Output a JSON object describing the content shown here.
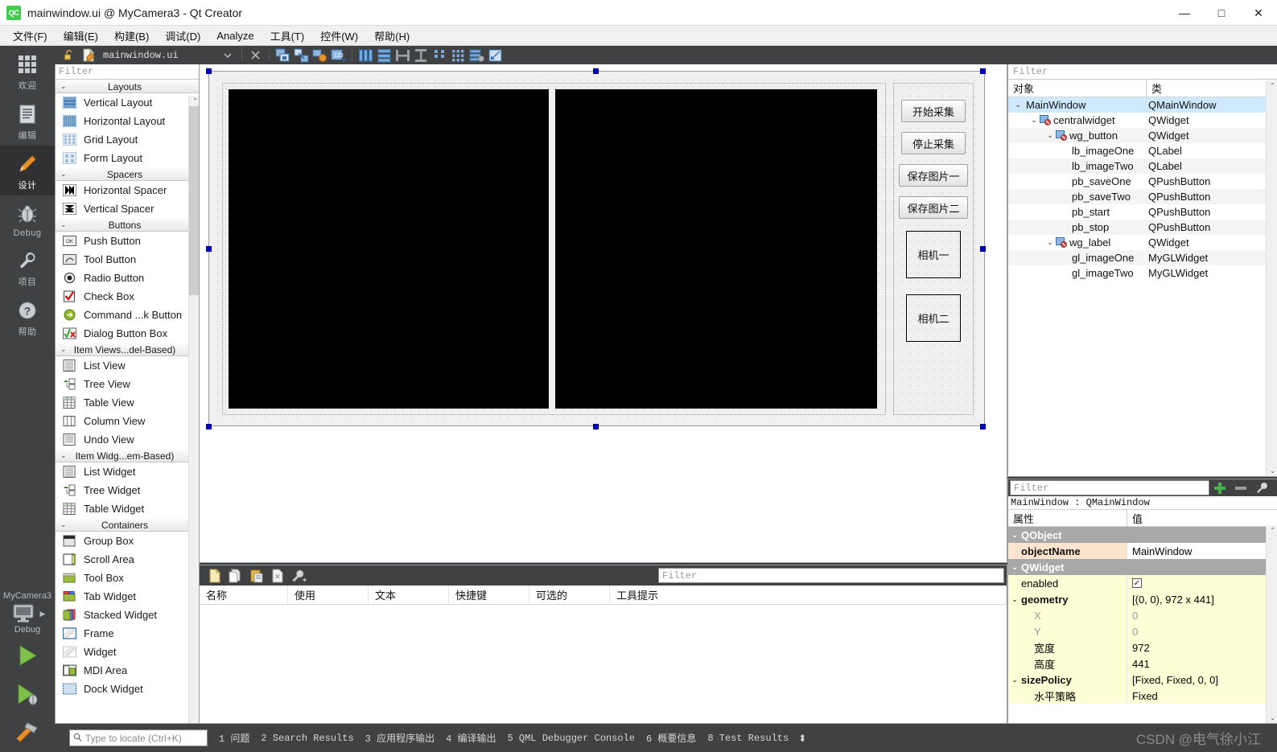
{
  "window": {
    "title": "mainwindow.ui @ MyCamera3 - Qt Creator",
    "logo": "QC",
    "controls": {
      "minimize": "—",
      "maximize": "□",
      "close": "✕"
    }
  },
  "menubar": {
    "items": [
      {
        "label": "文件(F)"
      },
      {
        "label": "编辑(E)"
      },
      {
        "label": "构建(B)"
      },
      {
        "label": "调试(D)"
      },
      {
        "label": "Analyze"
      },
      {
        "label": "工具(T)"
      },
      {
        "label": "控件(W)"
      },
      {
        "label": "帮助(H)"
      }
    ]
  },
  "activitybar": {
    "items": [
      {
        "label": "欢迎",
        "icon": "grid-icon"
      },
      {
        "label": "编辑",
        "icon": "document-icon"
      },
      {
        "label": "设计",
        "icon": "pencil-icon"
      },
      {
        "label": "Debug",
        "icon": "bug-icon"
      },
      {
        "label": "项目",
        "icon": "wrench-icon"
      },
      {
        "label": "帮助",
        "icon": "question-icon"
      }
    ],
    "active_index": 2,
    "kit": {
      "project": "MyCamera3",
      "config": "Debug"
    }
  },
  "editor_toolbar": {
    "filename": "mainwindow.ui",
    "lock_icon": "unlock-icon",
    "file_icon": "ui-file-icon",
    "dropdown_icon": "chevron-down-icon",
    "close_icon": "close-icon",
    "tool_icons": [
      "edit-widgets-icon",
      "edit-signals-icon",
      "edit-buddies-icon",
      "edit-tab-order-icon",
      "layout-horizontal-icon",
      "layout-vertical-icon",
      "layout-splitter-h-icon",
      "layout-splitter-v-icon",
      "layout-form-icon",
      "layout-grid-icon",
      "break-layout-icon",
      "adjust-size-icon"
    ]
  },
  "widget_box": {
    "filter_placeholder": "Filter",
    "groups": [
      {
        "title": "Layouts",
        "expanded": true,
        "items": [
          {
            "label": "Vertical Layout",
            "icon": "vertical-layout-icon"
          },
          {
            "label": "Horizontal Layout",
            "icon": "horizontal-layout-icon"
          },
          {
            "label": "Grid Layout",
            "icon": "grid-layout-icon"
          },
          {
            "label": "Form Layout",
            "icon": "form-layout-icon"
          }
        ]
      },
      {
        "title": "Spacers",
        "expanded": true,
        "items": [
          {
            "label": "Horizontal Spacer",
            "icon": "horizontal-spacer-icon"
          },
          {
            "label": "Vertical Spacer",
            "icon": "vertical-spacer-icon"
          }
        ]
      },
      {
        "title": "Buttons",
        "expanded": true,
        "items": [
          {
            "label": "Push Button",
            "icon": "push-button-icon"
          },
          {
            "label": "Tool Button",
            "icon": "tool-button-icon"
          },
          {
            "label": "Radio Button",
            "icon": "radio-button-icon"
          },
          {
            "label": "Check Box",
            "icon": "check-box-icon"
          },
          {
            "label": "Command ...k Button",
            "icon": "command-link-icon"
          },
          {
            "label": "Dialog Button Box",
            "icon": "dialog-button-box-icon"
          }
        ]
      },
      {
        "title": "Item Views...del-Based)",
        "expanded": true,
        "items": [
          {
            "label": "List View",
            "icon": "list-view-icon"
          },
          {
            "label": "Tree View",
            "icon": "tree-view-icon"
          },
          {
            "label": "Table View",
            "icon": "table-view-icon"
          },
          {
            "label": "Column View",
            "icon": "column-view-icon"
          },
          {
            "label": "Undo View",
            "icon": "undo-view-icon"
          }
        ]
      },
      {
        "title": "Item Widg...em-Based)",
        "expanded": true,
        "items": [
          {
            "label": "List Widget",
            "icon": "list-widget-icon"
          },
          {
            "label": "Tree Widget",
            "icon": "tree-widget-icon"
          },
          {
            "label": "Table Widget",
            "icon": "table-widget-icon"
          }
        ]
      },
      {
        "title": "Containers",
        "expanded": true,
        "items": [
          {
            "label": "Group Box",
            "icon": "group-box-icon"
          },
          {
            "label": "Scroll Area",
            "icon": "scroll-area-icon"
          },
          {
            "label": "Tool Box",
            "icon": "tool-box-icon"
          },
          {
            "label": "Tab Widget",
            "icon": "tab-widget-icon"
          },
          {
            "label": "Stacked Widget",
            "icon": "stacked-widget-icon"
          },
          {
            "label": "Frame",
            "icon": "frame-icon"
          },
          {
            "label": "Widget",
            "icon": "widget-icon"
          },
          {
            "label": "MDI Area",
            "icon": "mdi-area-icon"
          },
          {
            "label": "Dock Widget",
            "icon": "dock-widget-icon"
          }
        ]
      }
    ]
  },
  "form": {
    "gl_widgets": [
      {
        "name": "gl_imageOne"
      },
      {
        "name": "gl_imageTwo"
      }
    ],
    "buttons": [
      {
        "label": "开始采集",
        "name": "pb_start"
      },
      {
        "label": "停止采集",
        "name": "pb_stop"
      },
      {
        "label": "保存图片一",
        "name": "pb_saveOne"
      },
      {
        "label": "保存图片二",
        "name": "pb_saveTwo"
      }
    ],
    "labels": [
      {
        "label": "相机一",
        "name": "lb_imageOne"
      },
      {
        "label": "相机二",
        "name": "lb_imageTwo"
      }
    ]
  },
  "action_editor": {
    "filter_placeholder": "Filter",
    "tool_icons": [
      "new-action-icon",
      "copy-icon",
      "paste-icon",
      "delete-icon",
      "configure-icon"
    ],
    "columns": [
      "名称",
      "使用",
      "文本",
      "快捷键",
      "可选的",
      "工具提示"
    ],
    "rows": []
  },
  "object_inspector": {
    "filter_placeholder": "Filter",
    "columns": [
      "对象",
      "类"
    ],
    "rows": [
      {
        "object": "MainWindow",
        "class": "QMainWindow",
        "indent": 0,
        "chevron": true,
        "icon": null,
        "selected": true
      },
      {
        "object": "centralwidget",
        "class": "QWidget",
        "indent": 1,
        "chevron": true,
        "icon": "layout-none-icon",
        "selected": false
      },
      {
        "object": "wg_button",
        "class": "QWidget",
        "indent": 2,
        "chevron": true,
        "icon": "layout-none-icon",
        "selected": false
      },
      {
        "object": "lb_imageOne",
        "class": "QLabel",
        "indent": 3,
        "chevron": false,
        "icon": null,
        "selected": false
      },
      {
        "object": "lb_imageTwo",
        "class": "QLabel",
        "indent": 3,
        "chevron": false,
        "icon": null,
        "selected": false
      },
      {
        "object": "pb_saveOne",
        "class": "QPushButton",
        "indent": 3,
        "chevron": false,
        "icon": null,
        "selected": false
      },
      {
        "object": "pb_saveTwo",
        "class": "QPushButton",
        "indent": 3,
        "chevron": false,
        "icon": null,
        "selected": false
      },
      {
        "object": "pb_start",
        "class": "QPushButton",
        "indent": 3,
        "chevron": false,
        "icon": null,
        "selected": false
      },
      {
        "object": "pb_stop",
        "class": "QPushButton",
        "indent": 3,
        "chevron": false,
        "icon": null,
        "selected": false
      },
      {
        "object": "wg_label",
        "class": "QWidget",
        "indent": 2,
        "chevron": true,
        "icon": "layout-none-icon",
        "selected": false
      },
      {
        "object": "gl_imageOne",
        "class": "MyGLWidget",
        "indent": 3,
        "chevron": false,
        "icon": null,
        "selected": false
      },
      {
        "object": "gl_imageTwo",
        "class": "MyGLWidget",
        "indent": 3,
        "chevron": false,
        "icon": null,
        "selected": false
      }
    ]
  },
  "property_editor": {
    "filter_placeholder": "Filter",
    "add_icon": "plus-icon",
    "remove_icon": "minus-icon",
    "config_icon": "wrench-icon",
    "subject": "MainWindow : QMainWindow",
    "columns": [
      "属性",
      "值"
    ],
    "rows": [
      {
        "key": "QObject",
        "value": "",
        "type": "group",
        "indent": 0,
        "chevron": true
      },
      {
        "key": "objectName",
        "value": "MainWindow",
        "type": "orange",
        "indent": 1,
        "chevron": false,
        "bold": true
      },
      {
        "key": "QWidget",
        "value": "",
        "type": "group",
        "indent": 0,
        "chevron": true
      },
      {
        "key": "enabled",
        "value": "",
        "type": "check",
        "indent": 1,
        "chevron": false
      },
      {
        "key": "geometry",
        "value": "[(0, 0), 972 x 441]",
        "type": "yellow",
        "indent": 0,
        "chevron": true,
        "bold": true
      },
      {
        "key": "X",
        "value": "0",
        "type": "dim",
        "indent": 2,
        "chevron": false
      },
      {
        "key": "Y",
        "value": "0",
        "type": "dim",
        "indent": 2,
        "chevron": false
      },
      {
        "key": "宽度",
        "value": "972",
        "type": "yellow",
        "indent": 2,
        "chevron": false
      },
      {
        "key": "高度",
        "value": "441",
        "type": "yellow",
        "indent": 2,
        "chevron": false
      },
      {
        "key": "sizePolicy",
        "value": "[Fixed, Fixed, 0, 0]",
        "type": "yellow",
        "indent": 0,
        "chevron": true,
        "bold": true
      },
      {
        "key": "水平策略",
        "value": "Fixed",
        "type": "yellow",
        "indent": 2,
        "chevron": false
      }
    ]
  },
  "statusbar": {
    "locate_placeholder": "Type to locate (Ctrl+K)",
    "search_icon": "search-icon",
    "panes": [
      {
        "num": "1",
        "label": "问题"
      },
      {
        "num": "2",
        "label": "Search Results"
      },
      {
        "num": "3",
        "label": "应用程序输出"
      },
      {
        "num": "4",
        "label": "编译输出"
      },
      {
        "num": "5",
        "label": "QML Debugger Console"
      },
      {
        "num": "6",
        "label": "概要信息"
      },
      {
        "num": "8",
        "label": "Test Results"
      }
    ],
    "updown": "⬍"
  },
  "watermark": "CSDN @电气徐小江"
}
